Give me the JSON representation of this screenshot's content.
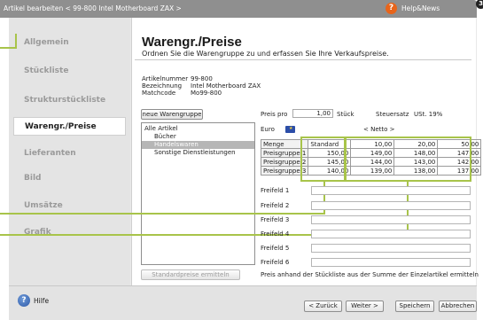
{
  "titlebar": {
    "text": "Artikel bearbeiten < 99-800 Intel Motherboard ZAX >",
    "help_news": "Help&News",
    "help_glyph": "?",
    "corner_badge": "3"
  },
  "sidebar": {
    "items": [
      {
        "label": "Allgemein",
        "active": false
      },
      {
        "label": "Stückliste",
        "active": false
      },
      {
        "label": "Strukturstückliste",
        "active": false
      },
      {
        "label": "Warengr./Preise",
        "active": true
      },
      {
        "label": "Lieferanten",
        "active": false
      },
      {
        "label": "Bild",
        "active": false
      },
      {
        "label": "Umsätze",
        "active": false
      },
      {
        "label": "Grafik",
        "active": false
      }
    ]
  },
  "header": {
    "title": "Warengr./Preise",
    "subtitle": "Ordnen Sie die Warengruppe zu und erfassen Sie Ihre Verkaufspreise."
  },
  "article": {
    "artikelnummer_label": "Artikelnummer",
    "artikelnummer": "99-800",
    "bezeichnung_label": "Bezeichnung",
    "bezeichnung": "Intel Motherboard ZAX",
    "matchcode_label": "Matchcode",
    "matchcode": "Mo99-800"
  },
  "warengruppen": {
    "new_button": "neue Warengruppe",
    "items": [
      {
        "label": "Alle Artikel",
        "indent": 0,
        "selected": false
      },
      {
        "label": "Bücher",
        "indent": 1,
        "selected": false
      },
      {
        "label": "Handelswaren",
        "indent": 1,
        "selected": true
      },
      {
        "label": "Sonstige Dienstleistungen",
        "indent": 1,
        "selected": false
      }
    ],
    "standard_button": "Standardpreise ermitteln"
  },
  "pricing": {
    "preis_pro_label": "Preis pro",
    "preis_pro_value": "1,00",
    "unit": "Stück",
    "steuersatz_label": "Steuersatz",
    "steuersatz_value": "USt. 19%",
    "currency_label": "Euro",
    "netto_label": "< Netto >"
  },
  "price_table": {
    "header": [
      "Menge",
      "Standard",
      "10,00",
      "20,00",
      "50,00"
    ],
    "rows": [
      [
        "Preisgruppe 1",
        "150,00",
        "149,00",
        "148,00",
        "147,00"
      ],
      [
        "Preisgruppe 2",
        "145,00",
        "144,00",
        "143,00",
        "142,00"
      ],
      [
        "Preisgruppe 3",
        "140,00",
        "139,00",
        "138,00",
        "137,00"
      ]
    ]
  },
  "freifelder": [
    "Freifeld 1",
    "Freifeld 2",
    "Freifeld 3",
    "Freifeld 4",
    "Freifeld 5",
    "Freifeld 6"
  ],
  "footnote": "Preis anhand der Stückliste aus der Summe der Einzelartikel ermitteln",
  "footer": {
    "help_label": "Hilfe",
    "help_glyph": "?",
    "back": "< Zurück",
    "next": "Weiter >",
    "save": "Speichern",
    "cancel": "Abbrechen"
  },
  "colors": {
    "highlight": "#a8c44a",
    "accent": "#e8641a",
    "titlebar": "#8f8f8f"
  }
}
